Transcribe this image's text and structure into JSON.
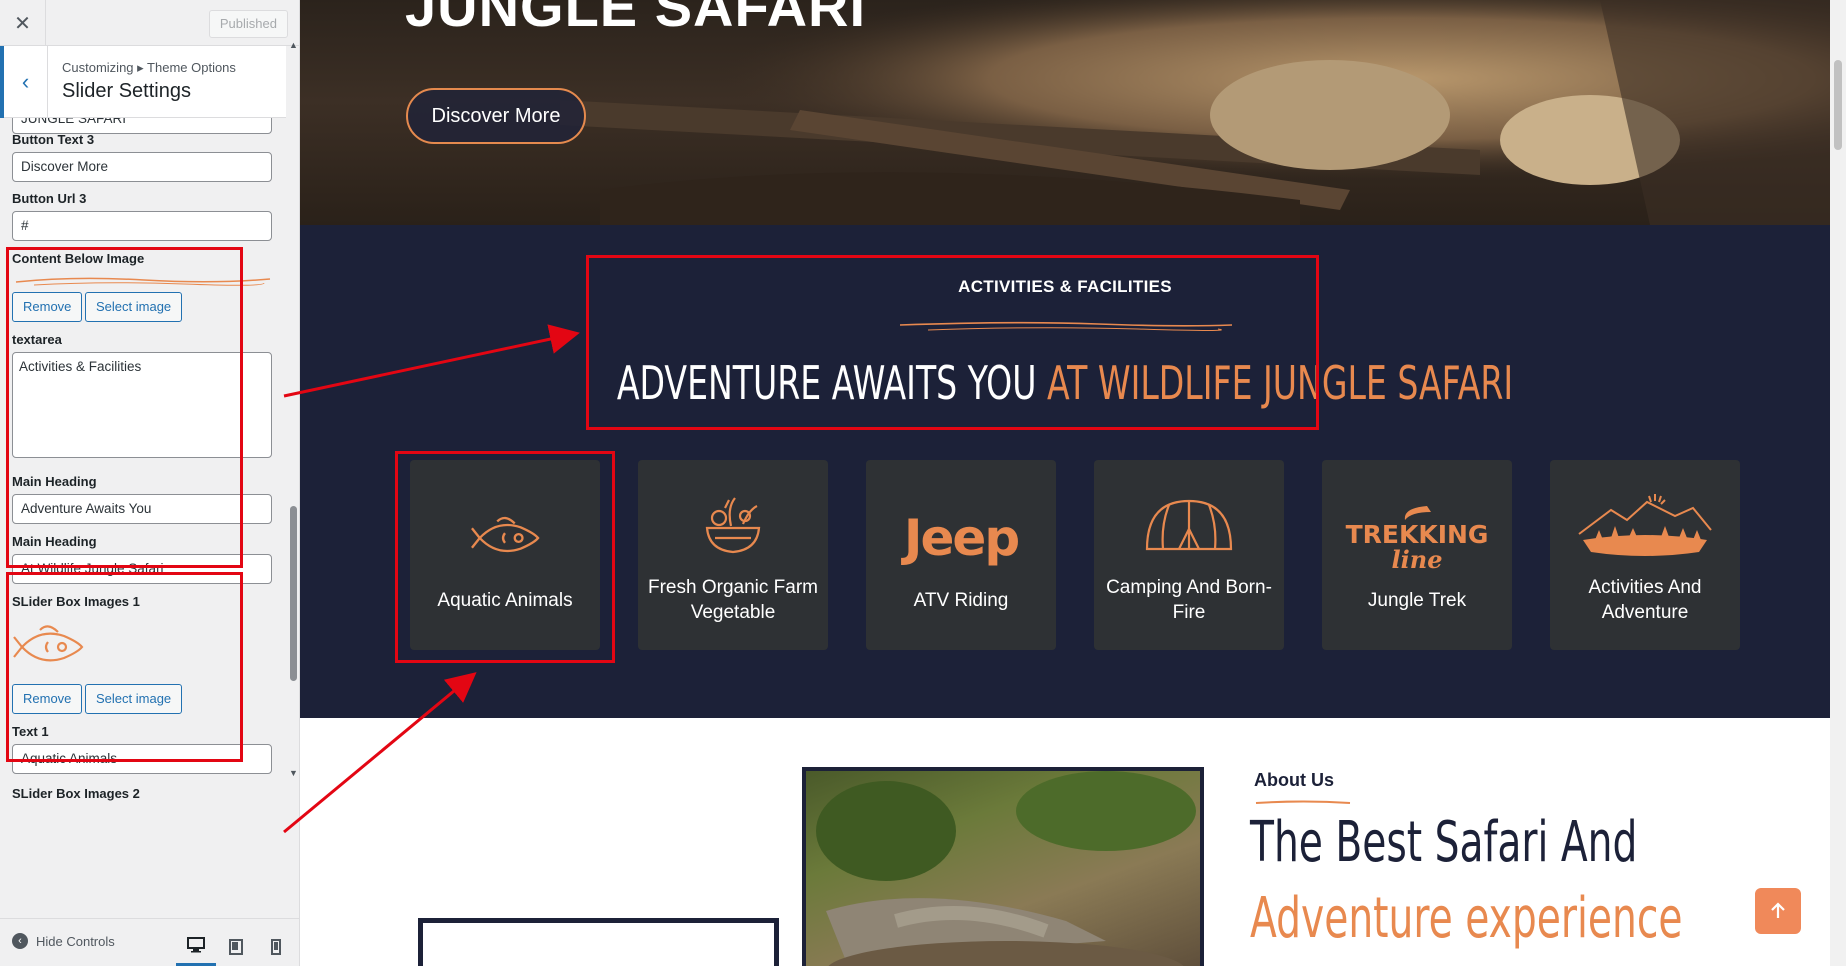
{
  "customizer": {
    "publish_label": "Published",
    "breadcrumb": "Customizing ▸ Theme Options",
    "section_title": "Slider Settings",
    "partial_value": "JUNGLE SAFARI",
    "button_text_label": "Button Text 3",
    "button_text_value": "Discover More",
    "button_url_label": "Button Url 3",
    "button_url_value": "#",
    "content_image_label": "Content Below Image",
    "remove_label": "Remove",
    "select_image_label": "Select image",
    "textarea_label": "textarea",
    "textarea_value": "Activities & Facilities",
    "main_heading_label_1": "Main Heading",
    "main_heading_value_1": "Adventure Awaits You",
    "main_heading_label_2": "Main Heading",
    "main_heading_value_2": "At Wildlife Jungle Safari",
    "slider_box_1_label": "SLider Box Images 1",
    "text_1_label": "Text 1",
    "text_1_value": "Aquatic Animals",
    "slider_box_2_label": "SLider Box Images 2",
    "hide_controls_label": "Hide Controls"
  },
  "preview": {
    "hero_title": "JUNGLE SAFARI",
    "hero_button": "Discover More",
    "kicker": "ACTIVITIES & FACILITIES",
    "heading_part1": "ADVENTURE AWAITS YOU",
    "heading_part2": "AT WILDLIFE JUNGLE SAFARI",
    "cards": [
      {
        "label": "Aquatic Animals",
        "icon": "fish-icon"
      },
      {
        "label": "Fresh Organic Farm Vegetable",
        "icon": "vegetable-bowl-icon"
      },
      {
        "label": "ATV Riding",
        "icon": "jeep-logo-icon",
        "logo_text": "Jeep"
      },
      {
        "label": "Camping And Born-Fire",
        "icon": "tent-icon"
      },
      {
        "label": "Jungle Trek",
        "icon": "trekking-logo-icon",
        "logo_text_1": "TREKKING",
        "logo_text_2": "line"
      },
      {
        "label": "Activities And Adventure",
        "icon": "mountain-landscape-icon"
      }
    ],
    "about_kicker": "About Us",
    "about_heading_1": "The Best Safari And",
    "about_heading_2": "Adventure experience"
  },
  "colors": {
    "accent": "#e8894f",
    "navy": "#1c2138",
    "card": "#2e3134",
    "annotation": "#e30613",
    "wp_blue": "#2271b1"
  }
}
